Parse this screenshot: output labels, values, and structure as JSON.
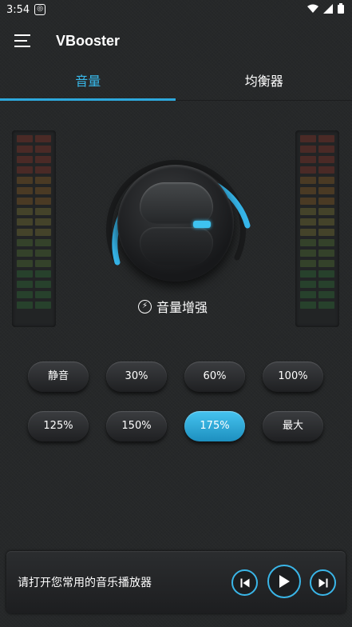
{
  "status_bar": {
    "time": "3:54",
    "icons": [
      "notification-app-icon",
      "wifi-icon",
      "signal-icon",
      "battery-icon"
    ]
  },
  "app_bar": {
    "title": "VBooster",
    "menu_icon": "menu-icon"
  },
  "tabs": [
    {
      "label": "音量",
      "active": true
    },
    {
      "label": "均衡器",
      "active": false
    }
  ],
  "knob": {
    "boost_label": "音量增强",
    "boost_icon": "lightning-icon",
    "level_fraction": 0.75
  },
  "presets": [
    {
      "label": "静音",
      "active": false
    },
    {
      "label": "30%",
      "active": false
    },
    {
      "label": "60%",
      "active": false
    },
    {
      "label": "100%",
      "active": false
    },
    {
      "label": "125%",
      "active": false
    },
    {
      "label": "150%",
      "active": false
    },
    {
      "label": "175%",
      "active": true
    },
    {
      "label": "最大",
      "active": false
    }
  ],
  "player": {
    "message": "请打开您常用的音乐播放器",
    "controls": [
      "skip-previous-icon",
      "play-icon",
      "skip-next-icon"
    ]
  },
  "colors": {
    "accent": "#38b8ea",
    "background": "#262829"
  }
}
